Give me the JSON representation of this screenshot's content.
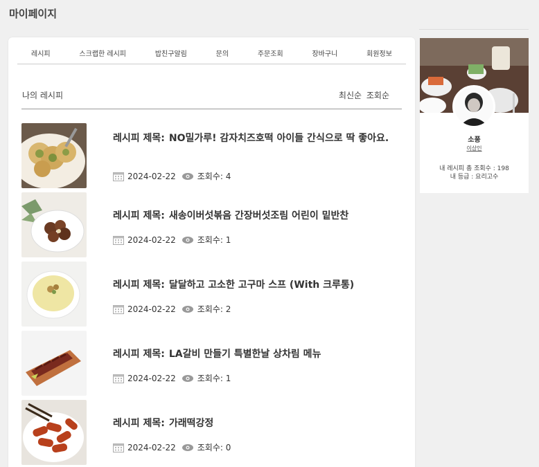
{
  "page": {
    "title": "마이페이지"
  },
  "tabs": [
    {
      "label": "레시피"
    },
    {
      "label": "스크랩한 레시피"
    },
    {
      "label": "밥친구알림"
    },
    {
      "label": "문의"
    },
    {
      "label": "주문조회"
    },
    {
      "label": "장바구니"
    },
    {
      "label": "회원정보"
    }
  ],
  "section": {
    "title": "나의 레시피",
    "sort_latest": "최신순",
    "sort_views": "조회순"
  },
  "recipe_prefix": "레시피 제목:",
  "recipes": [
    {
      "title": "NO밀가루! 감자치즈호떡 아이들 간식으로 딱 좋아요.",
      "date": "2024-02-22",
      "views": "조회수: 4"
    },
    {
      "title": "새송이버섯볶음 간장버섯조림 어린이 밑반찬",
      "date": "2024-02-22",
      "views": "조회수: 1"
    },
    {
      "title": "달달하고 고소한 고구마 스프 (With 크루통)",
      "date": "2024-02-22",
      "views": "조회수: 2"
    },
    {
      "title": "LA갈비 만들기 특별한날 상차림 메뉴",
      "date": "2024-02-22",
      "views": "조회수: 1"
    },
    {
      "title": "가래떡강정",
      "date": "2024-02-22",
      "views": "조회수: 0"
    }
  ],
  "profile": {
    "name": "소풍",
    "link": "이상인",
    "stat_views": "내 레시피 총 조회수 : 198",
    "stat_grade": "내 등급 : 요리고수"
  }
}
